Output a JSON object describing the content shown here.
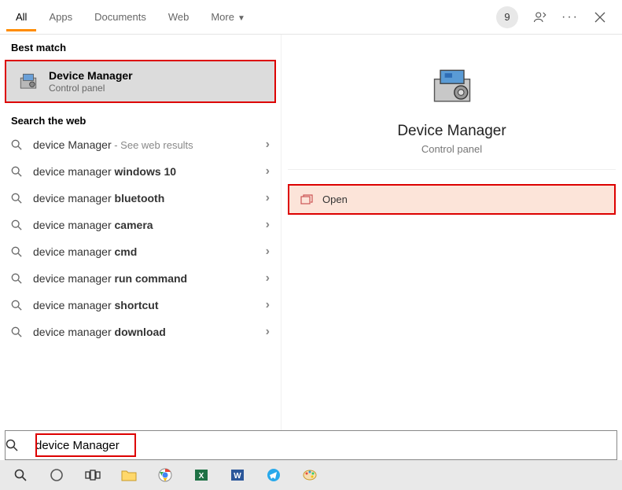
{
  "tabs": [
    "All",
    "Apps",
    "Documents",
    "Web",
    "More"
  ],
  "badge_count": "9",
  "sections": {
    "best_match_label": "Best match",
    "web_label": "Search the web"
  },
  "best_match": {
    "title": "Device Manager",
    "subtitle": "Control panel"
  },
  "web_results": [
    {
      "prefix": "device Manager",
      "bold": "",
      "hint": " - See web results"
    },
    {
      "prefix": "device manager ",
      "bold": "windows 10",
      "hint": ""
    },
    {
      "prefix": "device manager ",
      "bold": "bluetooth",
      "hint": ""
    },
    {
      "prefix": "device manager ",
      "bold": "camera",
      "hint": ""
    },
    {
      "prefix": "device manager ",
      "bold": "cmd",
      "hint": ""
    },
    {
      "prefix": "device manager ",
      "bold": "run command",
      "hint": ""
    },
    {
      "prefix": "device manager ",
      "bold": "shortcut",
      "hint": ""
    },
    {
      "prefix": "device manager ",
      "bold": "download",
      "hint": ""
    }
  ],
  "detail": {
    "title": "Device Manager",
    "subtitle": "Control panel",
    "action_open": "Open"
  },
  "search_value": "device Manager",
  "taskbar_icons": [
    "search",
    "cortana",
    "taskview",
    "explorer",
    "chrome",
    "excel",
    "word",
    "telegram",
    "paint"
  ]
}
